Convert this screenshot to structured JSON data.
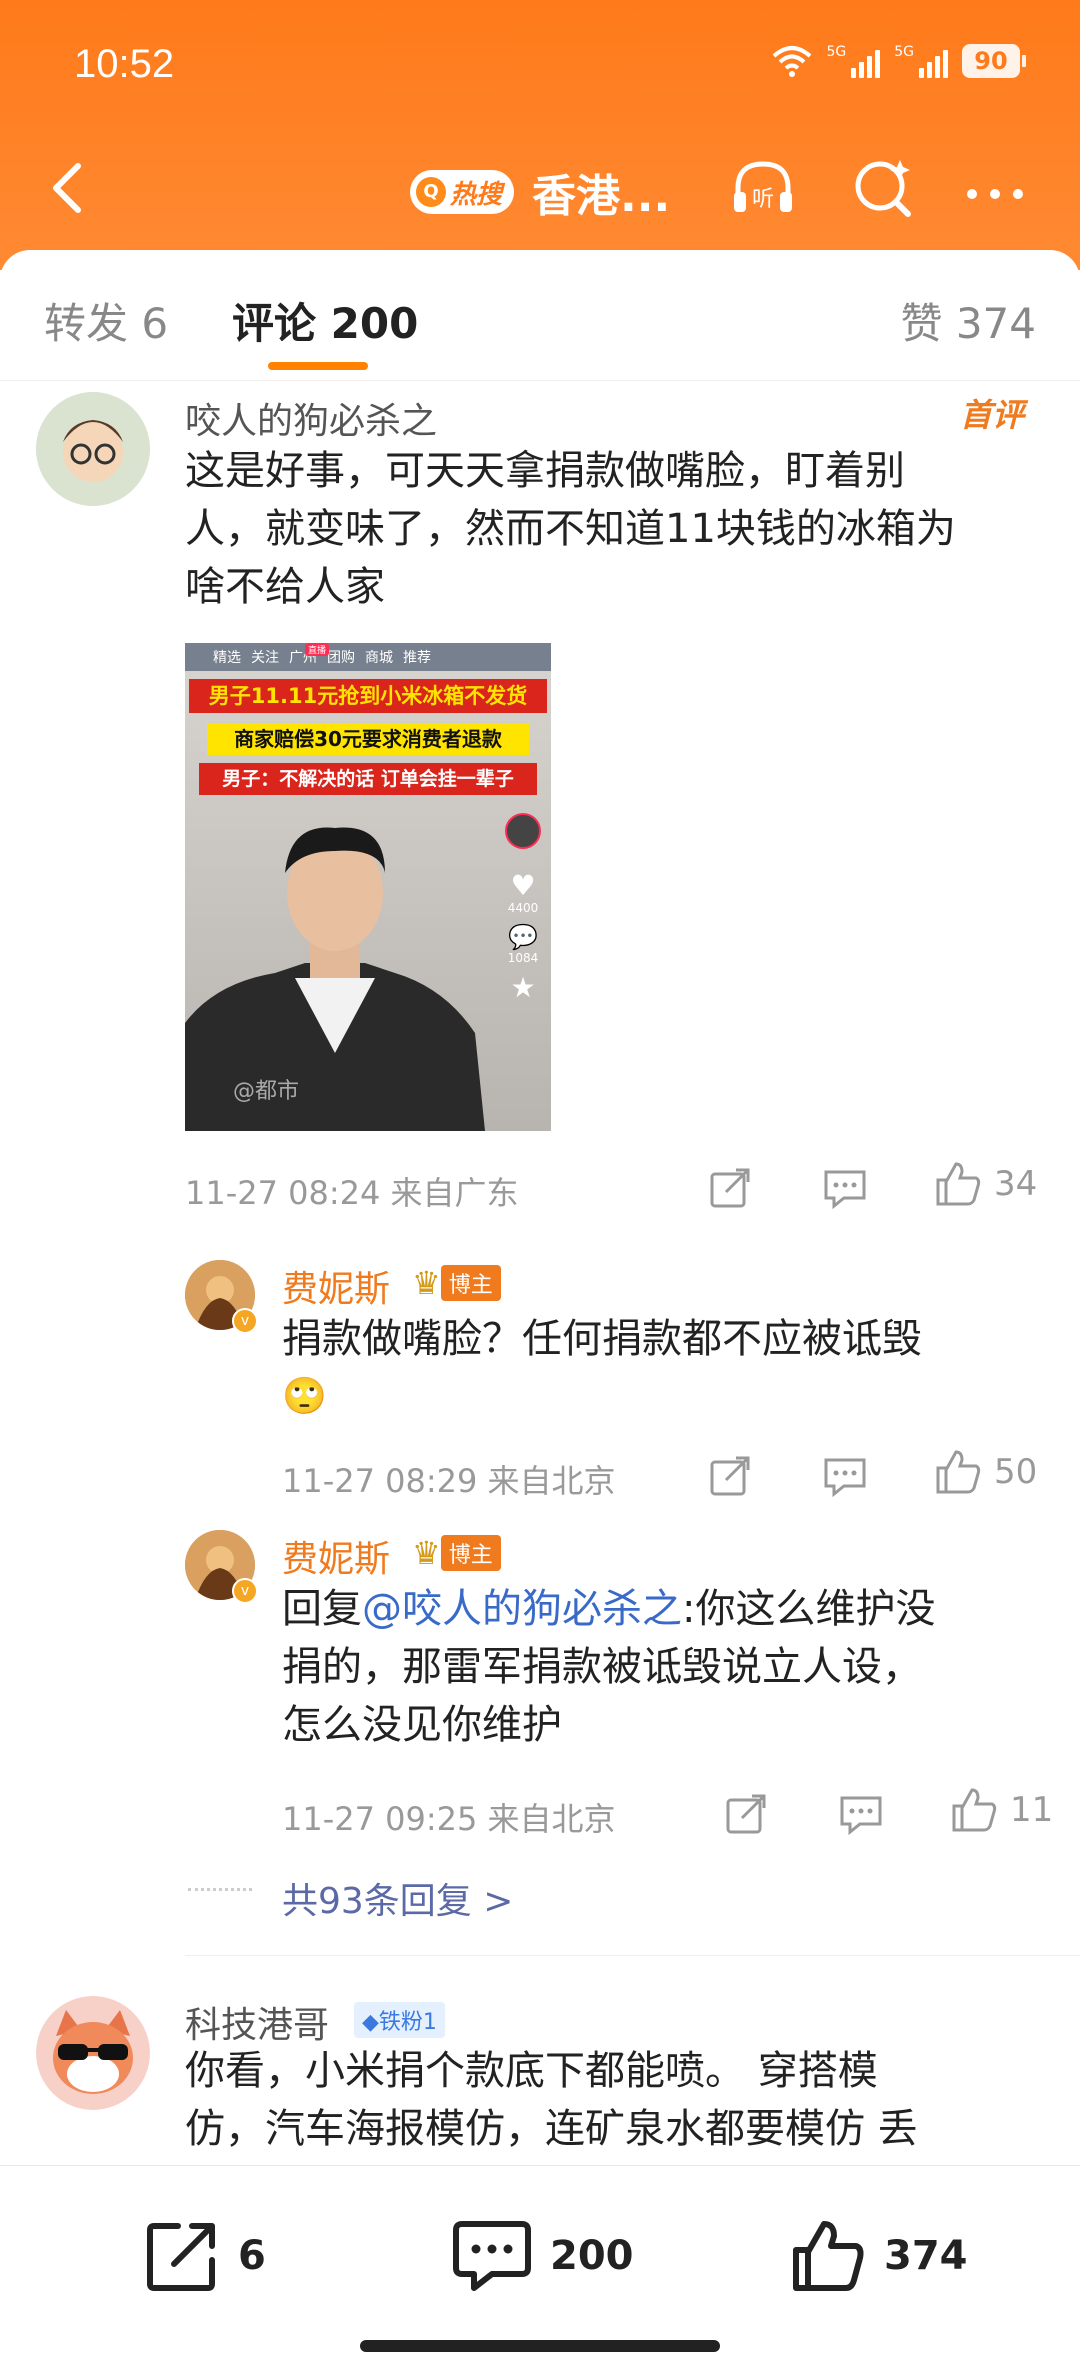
{
  "status_bar": {
    "time": "10:52",
    "signal1": "5G",
    "signal2": "5G",
    "battery": "90"
  },
  "nav": {
    "hot_badge": "热搜",
    "title": "香港...",
    "listen_label": "听"
  },
  "tabs": {
    "repost": "转发 6",
    "comment": "评论 200",
    "like": "赞 374"
  },
  "comments": [
    {
      "user": "咬人的狗必杀之",
      "tag": "首评",
      "text_lines": [
        "这是好事，可天天拿捐款做嘴脸，盯着别",
        "人，就变味了，然而不知道11块钱的冰箱为",
        "啥不给人家"
      ],
      "image": {
        "tabs": [
          "精选",
          "关注",
          "广州",
          "团购",
          "商城",
          "推荐"
        ],
        "live_tag": "直播",
        "banner1": "男子11.11元抢到小米冰箱不发货",
        "banner2": "商家赔偿30元要求消费者退款",
        "banner3": "男子：不解决的话 订单会挂一辈子",
        "likes": "4400",
        "comments": "1084",
        "watermark": "@都市"
      },
      "time": "11-27 08:24",
      "location": "来自广东",
      "likes": "34",
      "replies": [
        {
          "user": "费妮斯",
          "badge": "博主",
          "text_lines": [
            "捐款做嘴脸？任何捐款都不应被诋毁"
          ],
          "emoji": "🙄",
          "time": "11-27 08:29",
          "location": "来自北京",
          "likes": "50"
        },
        {
          "user": "费妮斯",
          "badge": "博主",
          "reply_prefix": "回复",
          "mention": "@咬人的狗必杀之",
          "text_first": ":你这么维护没",
          "text_lines": [
            "捐的，那雷军捐款被诋毁说立人设，",
            "怎么没见你维护"
          ],
          "time": "11-27 09:25",
          "location": "来自北京",
          "likes": "11"
        }
      ],
      "more_replies": "共93条回复 >"
    },
    {
      "user": "科技港哥",
      "fan_badge": "铁粉1",
      "text_lines": [
        "你看，小米捐个款底下都能喷。 穿搭模",
        "仿，汽车海报模仿，连矿泉水都要模仿 丢"
      ]
    }
  ],
  "bottom_bar": {
    "repost": "6",
    "comment": "200",
    "like": "374"
  },
  "colors": {
    "header": "#ff7a1a",
    "accent": "#ff8200",
    "username_orange": "#f07a1e",
    "link_blue": "#3a6ac8"
  }
}
